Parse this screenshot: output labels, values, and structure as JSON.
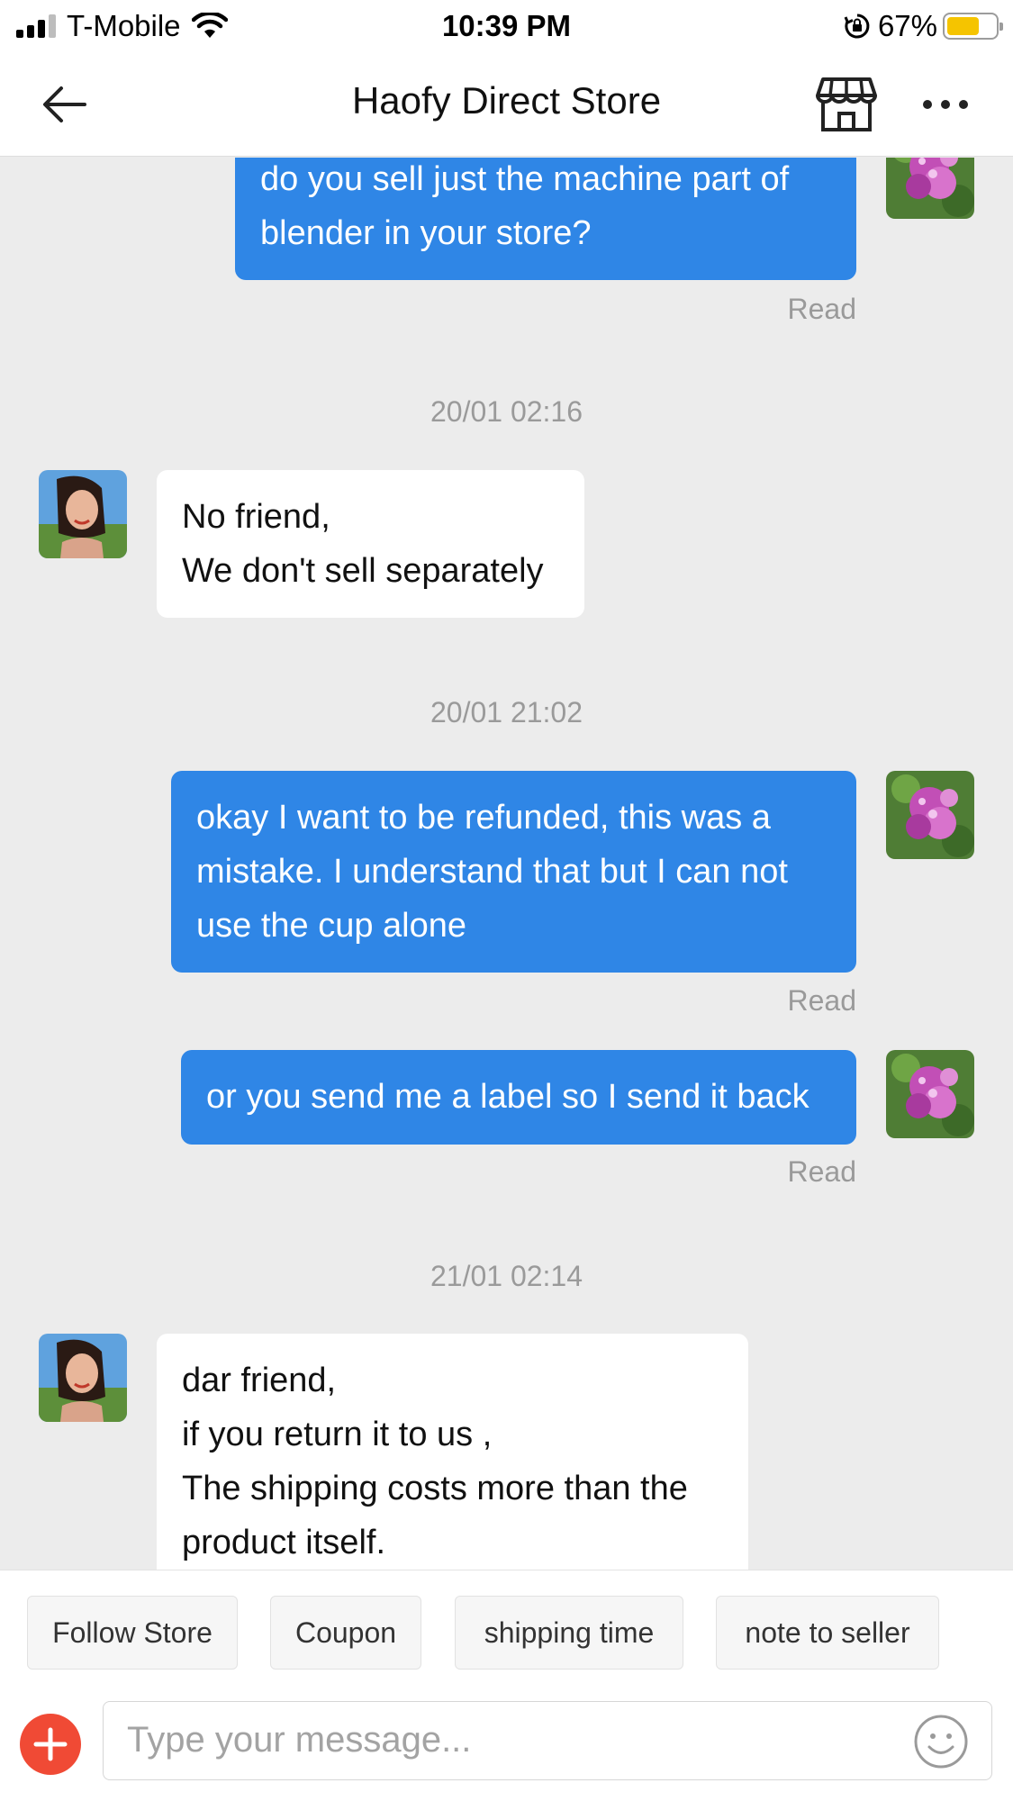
{
  "status_bar": {
    "carrier": "T-Mobile",
    "time": "10:39 PM",
    "battery_percent": "67%",
    "battery_level": 0.67,
    "battery_color": "#f5c400",
    "signal_bars": 3
  },
  "header": {
    "title": "Haofy Direct Store",
    "back_icon": "arrow-left-icon",
    "store_icon": "storefront-icon",
    "more_icon": "more-dots-icon"
  },
  "colors": {
    "outgoing_bubble": "#2f86e6",
    "accent_red": "#f04a35",
    "chat_background": "#ececec"
  },
  "messages": [
    {
      "direction": "out",
      "lines": [
        "do you sell just the machine part of",
        "blender in your store?"
      ],
      "status": "Read"
    },
    {
      "timestamp": "20/01 02:16"
    },
    {
      "direction": "in",
      "lines": [
        "No friend,",
        "We don't sell separately"
      ]
    },
    {
      "timestamp": "20/01 21:02"
    },
    {
      "direction": "out",
      "lines": [
        "okay I want to be refunded, this was a",
        "mistake. I understand that but I can not",
        "use the cup alone"
      ],
      "status": "Read"
    },
    {
      "direction": "out",
      "lines": [
        "or you send me a label so I send it back"
      ],
      "status": "Read"
    },
    {
      "timestamp": "21/01 02:14"
    },
    {
      "direction": "in",
      "lines": [
        "dar friend,",
        "if you return it to us ,",
        "The shipping costs more than the",
        "product itself."
      ]
    }
  ],
  "quick_replies": [
    "Follow Store",
    "Coupon",
    "shipping time",
    "note to seller"
  ],
  "composer": {
    "placeholder": "Type your message...",
    "add_icon": "plus-circle-icon",
    "emoji_icon": "smiley-icon"
  }
}
